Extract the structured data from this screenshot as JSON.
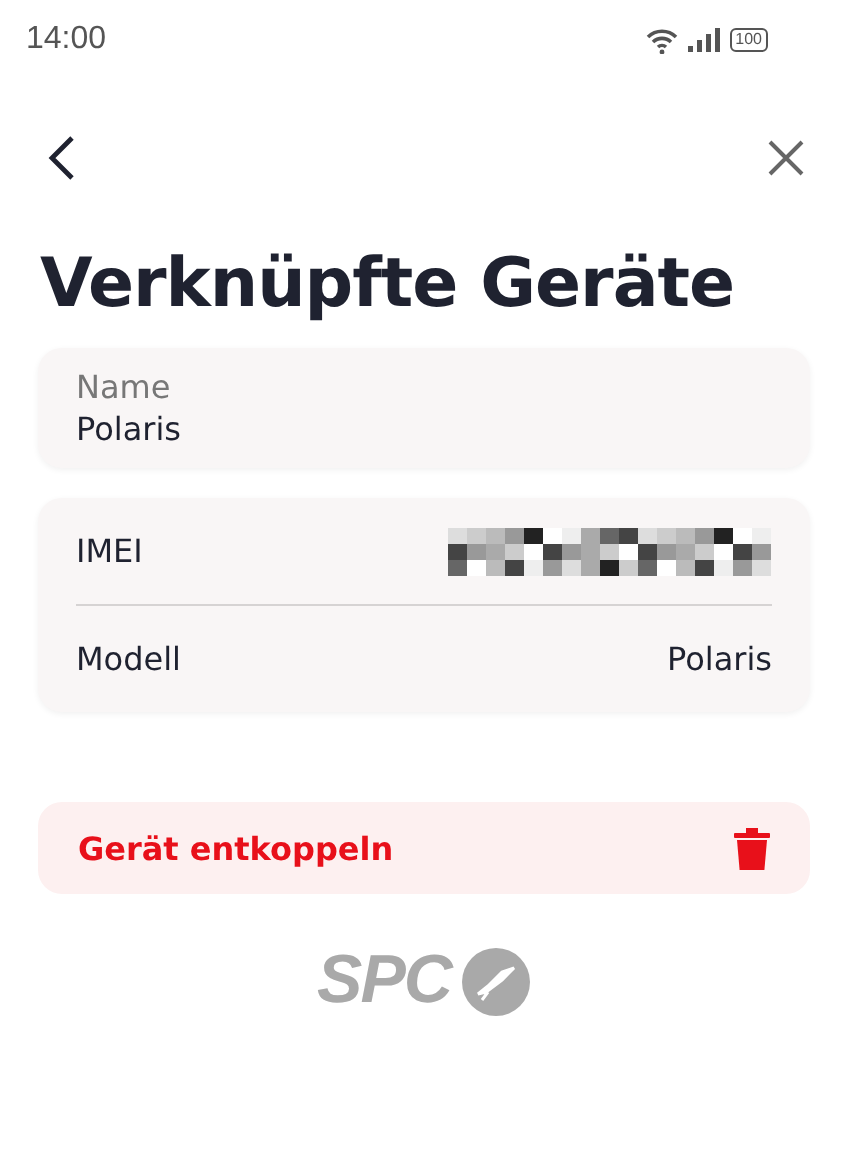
{
  "status_bar": {
    "time": "14:00",
    "battery": "100"
  },
  "title": "Verknüpfte Geräte",
  "name_field": {
    "label": "Name",
    "value": "Polaris"
  },
  "details": [
    {
      "kind": "redacted",
      "label": "IMEI"
    },
    {
      "kind": "text",
      "label": "Modell",
      "value": "Polaris"
    }
  ],
  "unlink_button": {
    "label": "Gerät entkoppeln"
  },
  "brand": "SPC"
}
